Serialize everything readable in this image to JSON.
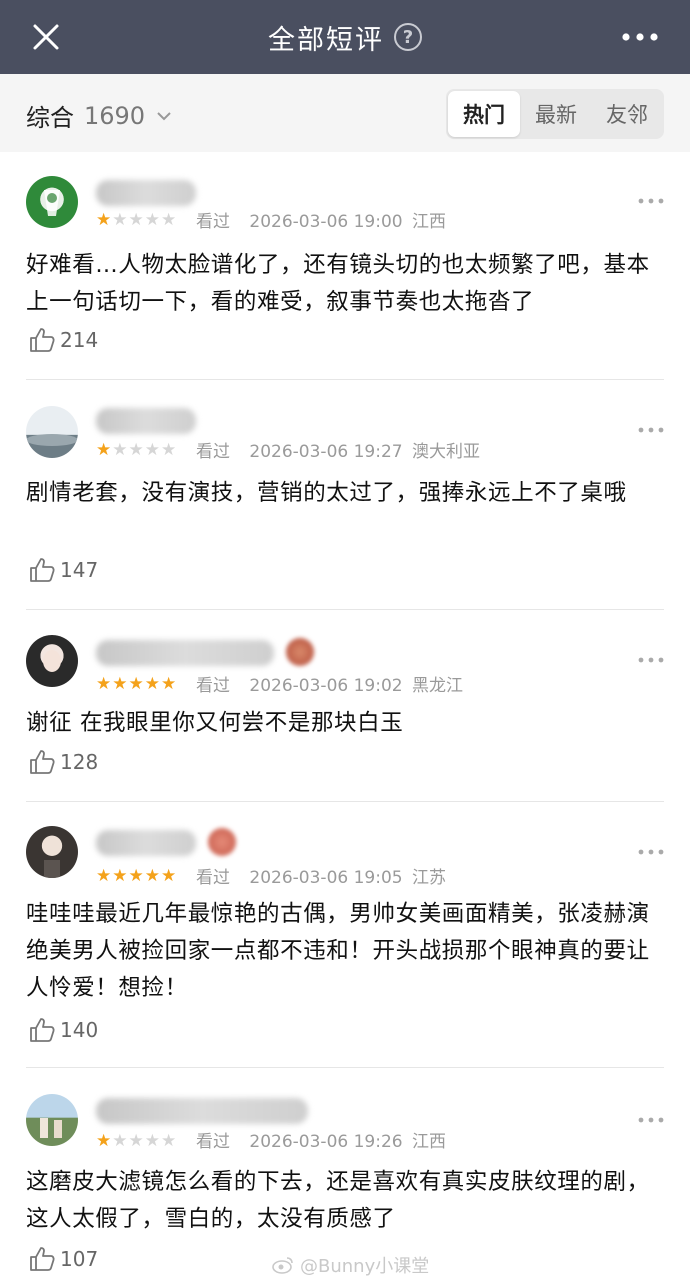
{
  "header": {
    "title": "全部短评",
    "help_icon": "help-circle-icon",
    "close_icon": "close-icon",
    "more_icon": "more-horizontal-icon",
    "background": "#4a4f60"
  },
  "filter": {
    "sort_label": "综合",
    "count": "1690",
    "tabs": [
      {
        "label": "热门",
        "active": true
      },
      {
        "label": "最新",
        "active": false
      },
      {
        "label": "友邻",
        "active": false
      }
    ]
  },
  "comments": [
    {
      "rating": 1,
      "status": "看过",
      "datetime": "2026-03-06 19:00",
      "location": "江西",
      "text": "好难看…人物太脸谱化了，还有镜头切的也太频繁了吧，基本上一句话切一下，看的难受，叙事节奏也太拖沓了",
      "likes": "214"
    },
    {
      "rating": 1,
      "status": "看过",
      "datetime": "2026-03-06 19:27",
      "location": "澳大利亚",
      "text": "剧情老套，没有演技，营销的太过了，强捧永远上不了桌哦",
      "likes": "147"
    },
    {
      "rating": 5,
      "status": "看过",
      "datetime": "2026-03-06 19:02",
      "location": "黑龙江",
      "text": "谢征 在我眼里你又何尝不是那块白玉",
      "likes": "128"
    },
    {
      "rating": 5,
      "status": "看过",
      "datetime": "2026-03-06 19:05",
      "location": "江苏",
      "text": "哇哇哇最近几年最惊艳的古偶，男帅女美画面精美，张凌赫演绝美男人被捡回家一点都不违和！开头战损那个眼神真的要让人怜爱！想捡！",
      "likes": "140"
    },
    {
      "rating": 1,
      "status": "看过",
      "datetime": "2026-03-06 19:26",
      "location": "江西",
      "text": "这磨皮大滤镜怎么看的下去，还是喜欢有真实皮肤纹理的剧，这人太假了，雪白的，太没有质感了",
      "likes": "107"
    }
  ],
  "watermark": "@Bunny小课堂",
  "colors": {
    "star_on": "#f4a21b",
    "star_off": "#d6d6d6"
  }
}
